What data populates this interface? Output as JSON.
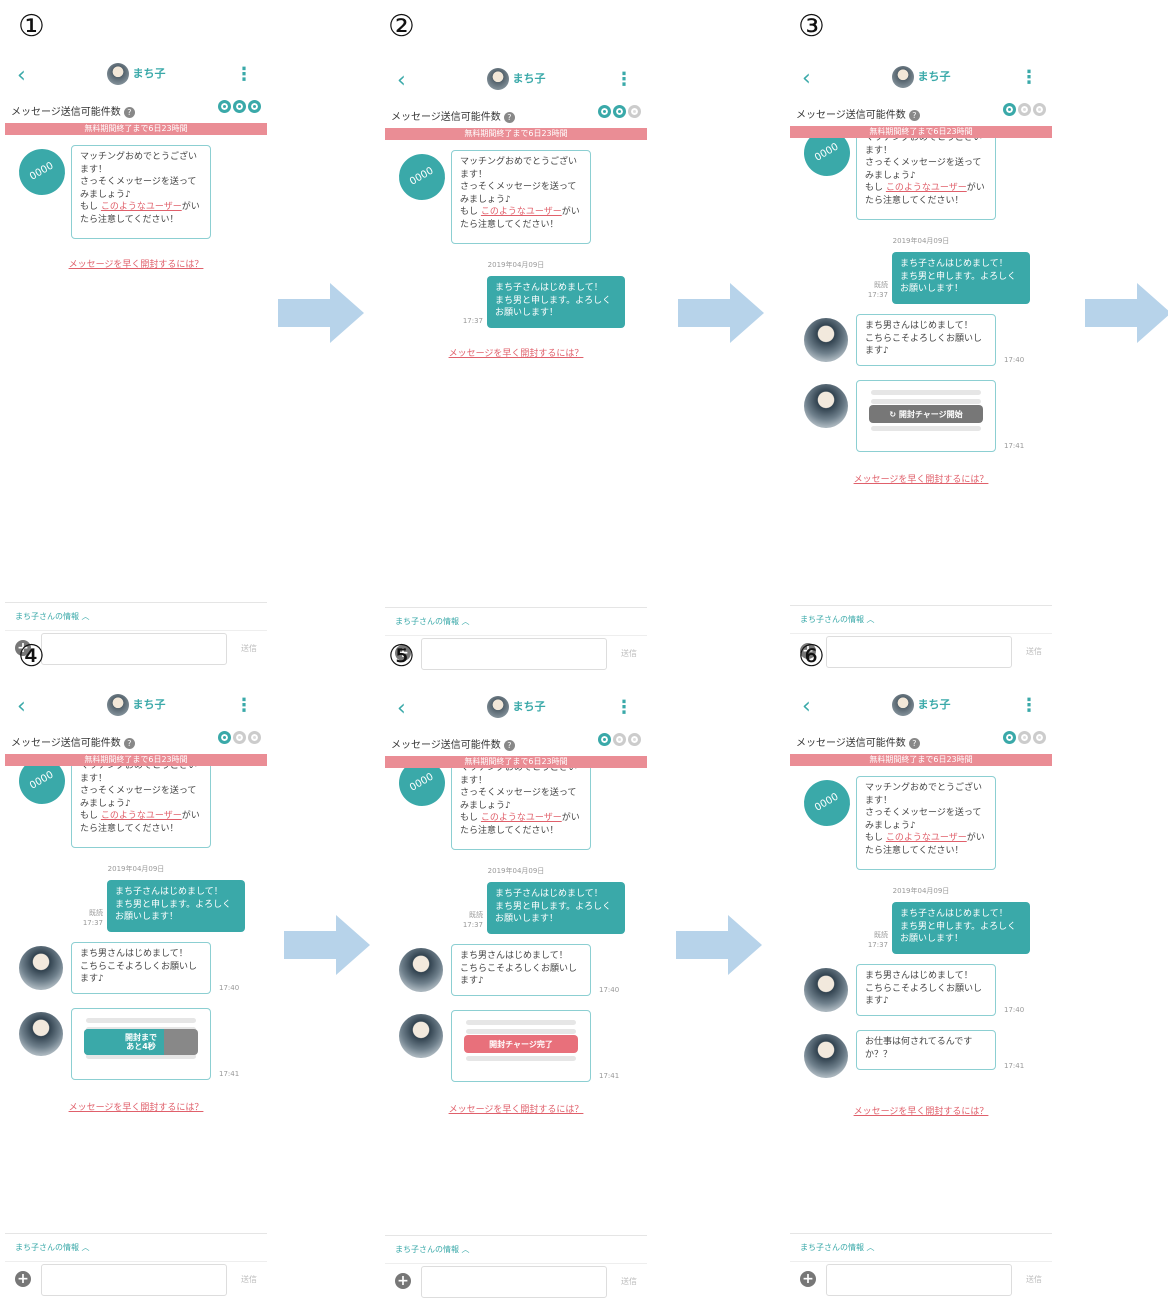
{
  "header": {
    "back_icon": "‹",
    "menu_icon": "⋮",
    "title": "まち子"
  },
  "quota": {
    "label": "メッセージ送信可能件数",
    "help": "?"
  },
  "banner": "無料期間終了まで6日23時間",
  "system_message": {
    "line1": "マッチングおめでとうござい",
    "line2": "ます！",
    "line3": "さっそくメッセージを送って",
    "line4": "みましょう♪",
    "prefix": "もし",
    "link": "このようなユーザー",
    "suffix": "がい",
    "line6": "たら注意してください！",
    "avatar": "0000"
  },
  "date": "2019年04月09日",
  "my_message": {
    "line1": "まち子さんはじめまして！",
    "line2": "まち男と申します。よろしく",
    "line3": "お願いします！",
    "read": "既読",
    "time": "17:37"
  },
  "their_message1": {
    "line1": "まち男さんはじめまして！",
    "line2": "こちらこそよろしくお願いし",
    "line3": "ます♪",
    "time": "17:40"
  },
  "their_message2_time": "17:41",
  "their_message_final": {
    "line1": "お仕事は何されてるんです",
    "line2": "か？？",
    "time": "17:41"
  },
  "overlays": {
    "charge_start": "↻ 開封チャージ開始",
    "countdown_line1": "開封まで",
    "countdown_line2": "あと4秒",
    "charge_done": "開封チャージ完了"
  },
  "open_link": "メッセージを早く開封するには？",
  "footer": {
    "info": "まち子さんの情報",
    "chevron": "︿",
    "plus": "+",
    "send": "送信"
  },
  "steps": [
    {
      "label": "①",
      "dots": [
        "on",
        "on",
        "on"
      ]
    },
    {
      "label": "②",
      "dots": [
        "on",
        "on",
        "off"
      ]
    },
    {
      "label": "③",
      "dots": [
        "on",
        "off",
        "off"
      ]
    },
    {
      "label": "④",
      "dots": [
        "on",
        "off",
        "off"
      ]
    },
    {
      "label": "⑤",
      "dots": [
        "on",
        "off",
        "off"
      ]
    },
    {
      "label": "⑥",
      "dots": [
        "on",
        "off",
        "off"
      ]
    }
  ],
  "colors": {
    "teal": "#3aa9a9",
    "pink": "#ea8d95",
    "arrow": "#b7d3ea"
  },
  "icons": [
    "back-icon",
    "menu-icon",
    "help-icon",
    "plus-icon",
    "arrow-right-icon"
  ]
}
